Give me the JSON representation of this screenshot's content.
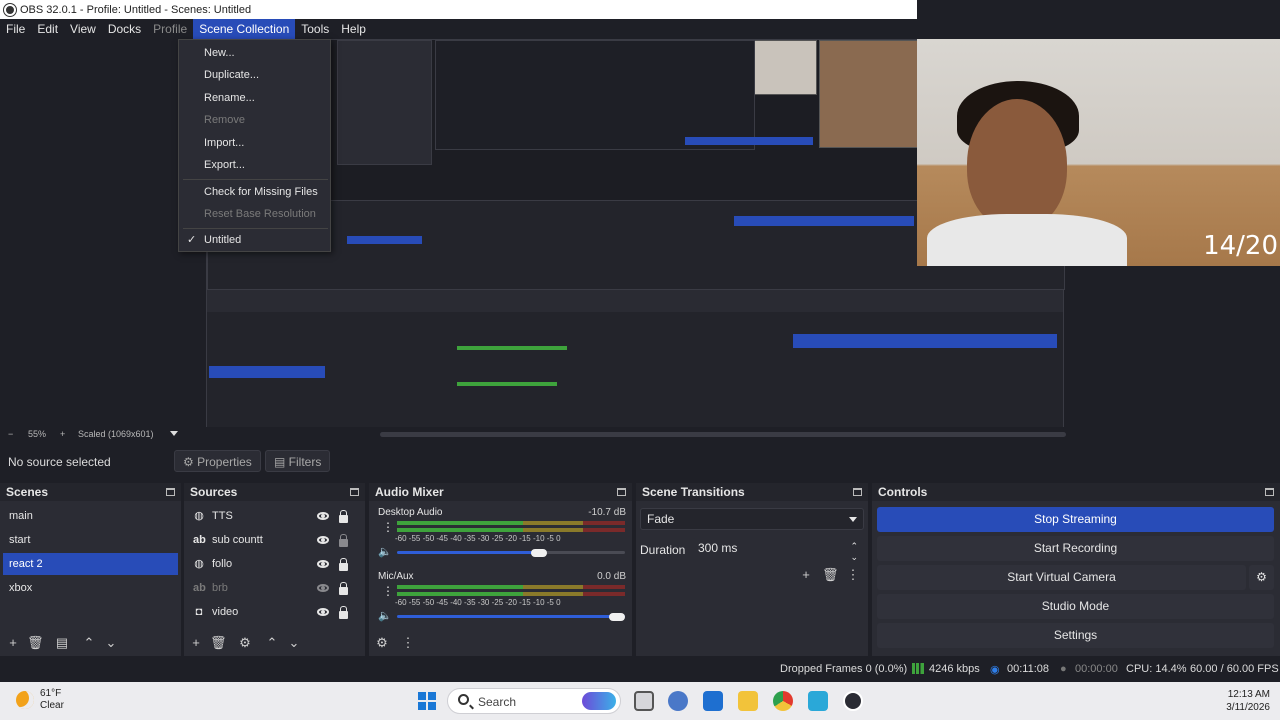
{
  "window": {
    "title": "OBS 32.0.1 - Profile: Untitled - Scenes: Untitled"
  },
  "menubar": {
    "items": [
      "File",
      "Edit",
      "View",
      "Docks",
      "Profile",
      "Scene Collection",
      "Tools",
      "Help"
    ],
    "active": "Scene Collection"
  },
  "scene_collection_menu": {
    "items": [
      {
        "label": "New...",
        "enabled": true
      },
      {
        "label": "Duplicate...",
        "enabled": true
      },
      {
        "label": "Rename...",
        "enabled": true
      },
      {
        "label": "Remove",
        "enabled": false
      },
      {
        "label": "Import...",
        "enabled": true
      },
      {
        "label": "Export...",
        "enabled": true
      },
      {
        "label": "Check for Missing Files",
        "enabled": true
      },
      {
        "label": "Reset Base Resolution",
        "enabled": false
      },
      {
        "label": "Untitled",
        "enabled": true,
        "checked": true
      }
    ],
    "check_glyph": "✓"
  },
  "webcam": {
    "overlay_text": "14/20"
  },
  "preview_status": {
    "zoom": "55%",
    "scale_mode": "Scaled (1069x601)"
  },
  "source_bar": {
    "no_source": "No source selected",
    "properties": "Properties",
    "filters": "Filters"
  },
  "scenes": {
    "title": "Scenes",
    "items": [
      "main",
      "start",
      "react 2",
      "xbox"
    ],
    "selected": "react 2"
  },
  "sources": {
    "title": "Sources",
    "items": [
      {
        "name": "TTS",
        "icon": "globe-icon",
        "visible": true
      },
      {
        "name": "sub countt",
        "icon": "text-icon",
        "visible": true
      },
      {
        "name": "follo",
        "icon": "globe-icon",
        "visible": true
      },
      {
        "name": "brb",
        "icon": "text-icon",
        "visible": false
      },
      {
        "name": "video",
        "icon": "camera-icon",
        "visible": true
      }
    ]
  },
  "audio_mixer": {
    "title": "Audio Mixer",
    "channels": [
      {
        "name": "Desktop Audio",
        "db": "-10.7 dB",
        "level_fraction": 0.62,
        "volume_fraction": 0.62
      },
      {
        "name": "Mic/Aux",
        "db": "0.0 dB",
        "level_fraction": 0.55,
        "volume_fraction": 1.0
      }
    ],
    "ticks": [
      "-60",
      "-55",
      "-50",
      "-45",
      "-40",
      "-35",
      "-30",
      "-25",
      "-20",
      "-15",
      "-10",
      "-5",
      "0"
    ]
  },
  "scene_transitions": {
    "title": "Scene Transitions",
    "transition": "Fade",
    "duration_label": "Duration",
    "duration_value": "300 ms"
  },
  "controls": {
    "title": "Controls",
    "stop_streaming": "Stop Streaming",
    "start_recording": "Start Recording",
    "start_virtual_camera": "Start Virtual Camera",
    "studio_mode": "Studio Mode",
    "settings": "Settings"
  },
  "statusbar": {
    "dropped_frames": "Dropped Frames 0 (0.0%)",
    "bitrate": "4246 kbps",
    "stream_time": "00:11:08",
    "record_time": "00:00:00",
    "cpu": "CPU: 14.4%",
    "fps": "60.00 / 60.00 FPS"
  },
  "taskbar": {
    "temperature": "61°F",
    "condition": "Clear",
    "search_placeholder": "Search",
    "time": "12:13 AM",
    "date": "3/11/2026"
  },
  "colors": {
    "accent": "#284cb8",
    "panel": "#2b2c34",
    "background": "#1e1f26"
  }
}
